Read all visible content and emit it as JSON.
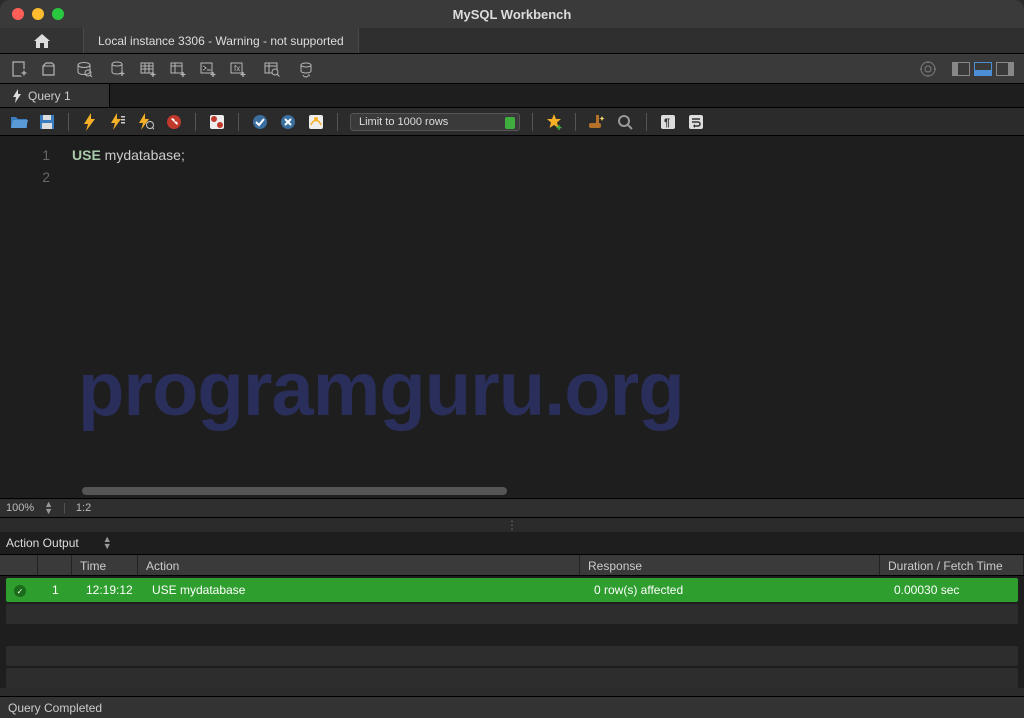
{
  "window": {
    "title": "MySQL Workbench"
  },
  "apptabs": {
    "connection": "Local instance 3306 - Warning - not supported"
  },
  "querytab": {
    "label": "Query 1"
  },
  "qtoolbar": {
    "limit": "Limit to 1000 rows"
  },
  "editor": {
    "lines": [
      "1",
      "2"
    ],
    "keyword": "USE",
    "rest": " mydatabase;",
    "watermark": "programguru.org"
  },
  "zoombar": {
    "zoom": "100%",
    "pos": "1:2"
  },
  "output": {
    "title": "Action Output",
    "headers": {
      "time": "Time",
      "action": "Action",
      "response": "Response",
      "duration": "Duration / Fetch Time"
    },
    "row": {
      "idx": "1",
      "time": "12:19:12",
      "action": "USE mydatabase",
      "response": "0 row(s) affected",
      "duration": "0.00030 sec"
    }
  },
  "status": {
    "text": "Query Completed"
  }
}
